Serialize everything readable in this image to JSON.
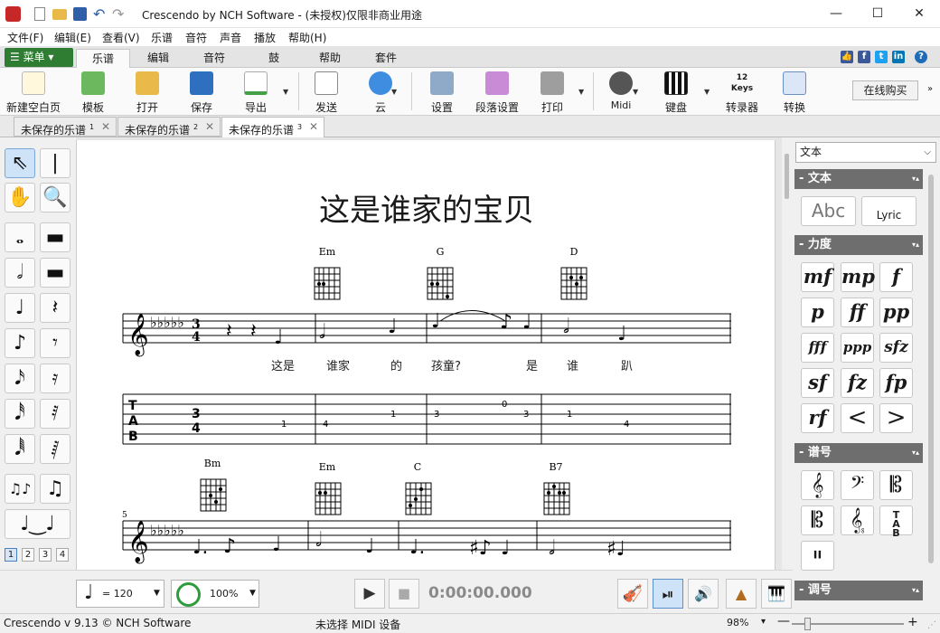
{
  "window": {
    "title": "Crescendo by NCH Software - (未授权)仅限非商业用途",
    "minimize": "—",
    "maximize": "☐",
    "close": "✕"
  },
  "menubar": [
    "文件(F)",
    "编辑(E)",
    "查看(V)",
    "乐谱",
    "音符",
    "声音",
    "播放",
    "帮助(H)"
  ],
  "ribbon_tabs": {
    "menu_button": "☰ 菜单 ▾",
    "tabs": [
      "乐谱",
      "编辑",
      "音符",
      "鼓",
      "帮助",
      "套件"
    ],
    "active": "乐谱"
  },
  "ribbon": {
    "buttons": [
      "新建空白页",
      "模板",
      "打开",
      "保存",
      "导出",
      "发送",
      "云",
      "设置",
      "段落设置",
      "打印",
      "Midi",
      "键盘",
      "转录器",
      "转换"
    ],
    "buy": "在线购买",
    "keys_label": "12 Keys"
  },
  "doc_tabs": [
    {
      "label": "未保存的乐谱",
      "num": "1"
    },
    {
      "label": "未保存的乐谱",
      "num": "2"
    },
    {
      "label": "未保存的乐谱",
      "num": "3"
    }
  ],
  "palette": {
    "pages": [
      "1",
      "2",
      "3",
      "4"
    ]
  },
  "score": {
    "title": "这是谁家的宝贝",
    "chords_row1": [
      "Em",
      "G",
      "D"
    ],
    "chords_row2": [
      "Bm",
      "Em",
      "C",
      "B7"
    ],
    "lyrics": [
      "这是",
      "谁家",
      "的",
      "孩童?",
      "是",
      "谁",
      "趴"
    ],
    "tab_numbers": [
      "1",
      "4",
      "1",
      "3",
      "0",
      "3",
      "1",
      "4"
    ],
    "measure_number": "5",
    "time_sig": "3",
    "time_sig_bottom": "4",
    "tab_letters": [
      "T",
      "A",
      "B"
    ]
  },
  "right_panel": {
    "select": "文本",
    "sections": [
      "文本",
      "力度",
      "谱号",
      "调号"
    ],
    "text_tools": [
      "Abc",
      "Lyric"
    ],
    "dynamics": [
      "mf",
      "mp",
      "f",
      "p",
      "ff",
      "pp",
      "fff",
      "ppp",
      "sfz",
      "sf",
      "fz",
      "fp",
      "rf",
      "<",
      ">"
    ]
  },
  "transport": {
    "tempo": "= 120",
    "volume": "100%",
    "time": "0:00:00.000"
  },
  "status": {
    "version": "Crescendo v 9.13 © NCH Software",
    "midi": "未选择 MIDI 设备",
    "zoom": "98%"
  },
  "colors": {
    "menu_green": "#2e7d32",
    "panel_header": "#6e6e6e",
    "accent_blue": "#1e6bb8"
  }
}
